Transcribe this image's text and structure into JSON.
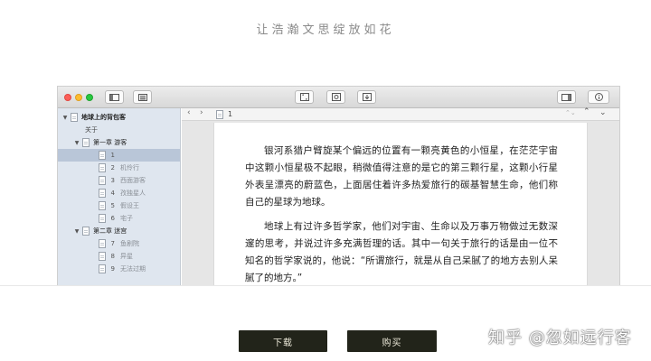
{
  "tagline": "让浩瀚文思绽放如花",
  "colors": {
    "button_bg": "#22241a",
    "sidebar_bg": "#dfe6ef",
    "sidebar_selected": "#b9c6d8"
  },
  "toolbar": {
    "icons": [
      "sidebar-toggle-icon",
      "outline-icon",
      "fullscreen-icon",
      "compile-icon",
      "download-icon",
      "inspector-icon",
      "info-icon"
    ]
  },
  "sidebar": {
    "root": {
      "label": "地球上的背包客"
    },
    "items": [
      {
        "label": "关于",
        "level": 1
      },
      {
        "label": "第一章 游客",
        "level": 1
      },
      {
        "num": "1",
        "label": "",
        "level": 2,
        "selected": true
      },
      {
        "num": "2",
        "label": "机伶行",
        "level": 2
      },
      {
        "num": "3",
        "label": "西面游客",
        "level": 2
      },
      {
        "num": "4",
        "label": "孜独星人",
        "level": 2
      },
      {
        "num": "5",
        "label": "假设王",
        "level": 2
      },
      {
        "num": "6",
        "label": "宅子",
        "level": 2
      },
      {
        "label": "第二章 迷宫",
        "level": 1
      },
      {
        "num": "7",
        "label": "鱼剧院",
        "level": 2
      },
      {
        "num": "8",
        "label": "异星",
        "level": 2
      },
      {
        "num": "9",
        "label": "无法过期",
        "level": 2
      }
    ]
  },
  "navbar": {
    "doc_title": "1"
  },
  "editor": {
    "paragraphs": [
      "银河系猎户臂旋某个偏远的位置有一颗亮黄色的小恒星，在茫茫宇宙中这颗小恒星极不起眼，稍微值得注意的是它的第三颗行星，这颗小行星外表呈漂亮的蔚蓝色，上面居住着许多热爱旅行的碳基智慧生命，他们称自己的星球为地球。",
      "地球上有过许多哲学家，他们对宇宙、生命以及万事万物做过无数深邃的思考，并说过许多充满哲理的话。其中一句关于旅行的话是由一位不知名的哲学家说的，他说：“所谓旅行，就是从自己呆腻了的地方去别人呆腻了的地方。”"
    ]
  },
  "actions": {
    "download": "下载",
    "buy": "购买"
  },
  "watermark": "知乎 @忽如远行客"
}
